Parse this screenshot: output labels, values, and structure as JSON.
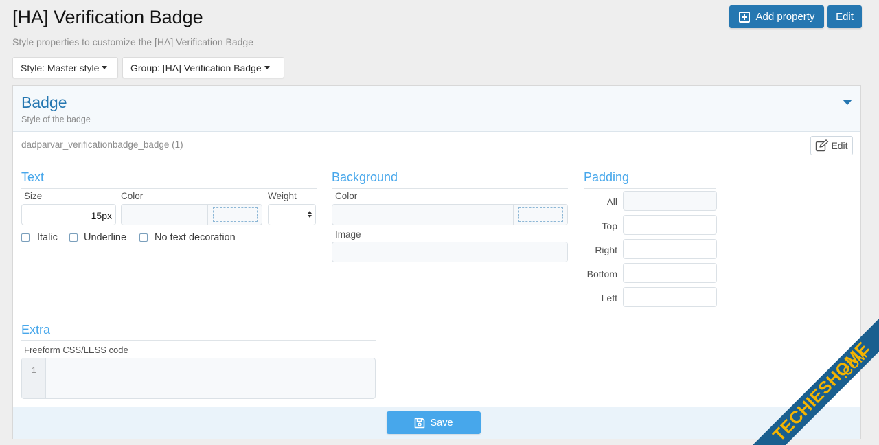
{
  "header": {
    "title": "[HA] Verification Badge",
    "description": "Style properties to customize the [HA] Verification Badge",
    "add_property_label": "Add property",
    "edit_label": "Edit"
  },
  "filters": {
    "style_label": "Style: Master style",
    "group_label": "Group: [HA] Verification Badge"
  },
  "panel": {
    "title": "Badge",
    "subtitle": "Style of the badge",
    "property_name": "dadparvar_verificationbadge_badge (1)",
    "edit_label": "Edit",
    "text": {
      "heading": "Text",
      "size_label": "Size",
      "size_value": "15px",
      "color_label": "Color",
      "weight_label": "Weight",
      "italic_label": "Italic",
      "underline_label": "Underline",
      "no_decoration_label": "No text decoration"
    },
    "background": {
      "heading": "Background",
      "color_label": "Color",
      "image_label": "Image"
    },
    "padding": {
      "heading": "Padding",
      "all_label": "All",
      "top_label": "Top",
      "right_label": "Right",
      "bottom_label": "Bottom",
      "left_label": "Left"
    },
    "extra": {
      "heading": "Extra",
      "code_label": "Freeform CSS/LESS code",
      "line_number": "1"
    },
    "save_label": "Save"
  },
  "watermark": {
    "text": "TECHIESHOME.COM",
    "colors": {
      "band": "#1a5f8f",
      "text": "#f5b400"
    }
  },
  "colors": {
    "primary_button": "#2577b1",
    "save_button": "#47a7eb",
    "section_heading": "#47a7eb",
    "panel_title": "#2577b1"
  }
}
